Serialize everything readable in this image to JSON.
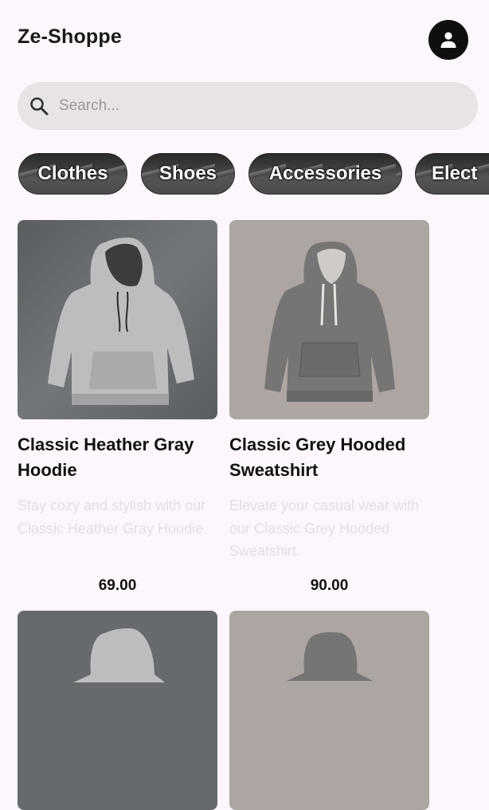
{
  "header": {
    "title": "Ze-Shoppe",
    "avatar_icon": "person-icon"
  },
  "search": {
    "placeholder": "Search...",
    "value": ""
  },
  "categories": [
    {
      "label": "Clothes"
    },
    {
      "label": "Shoes"
    },
    {
      "label": "Accessories"
    },
    {
      "label": "Elect"
    }
  ],
  "products": [
    {
      "name": "Classic Heather Gray Hoodie",
      "description": "Stay cozy and stylish with our Classic Heather Gray Hoodie.",
      "price": "69.00"
    },
    {
      "name": "Classic Grey Hooded Sweatshirt",
      "description": "Elevate your casual wear with our Classic Grey Hooded Sweatshirt.",
      "price": "90.00"
    }
  ],
  "colors": {
    "background": "#fdf6fd",
    "search_bg": "#e7e3e7",
    "avatar_bg": "#0f0f0f",
    "description_text": "#e4dde4"
  }
}
